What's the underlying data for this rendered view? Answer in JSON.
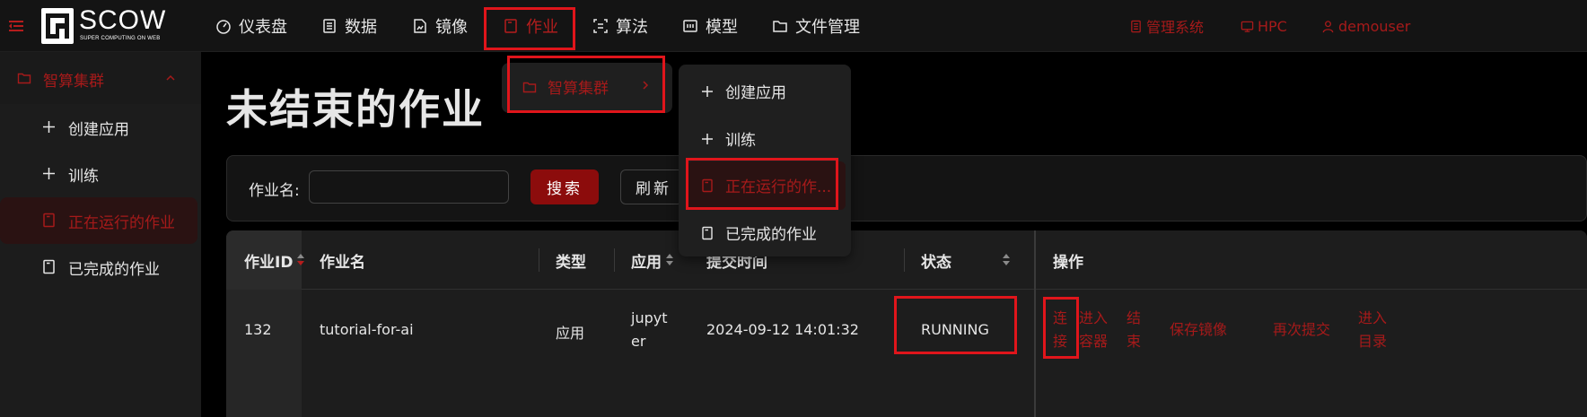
{
  "brand": {
    "name": "SCOW",
    "tagline": "SUPER COMPUTING ON WEB"
  },
  "nav": {
    "items": [
      {
        "label": "仪表盘",
        "icon": "dashboard-icon"
      },
      {
        "label": "数据",
        "icon": "database-icon"
      },
      {
        "label": "镜像",
        "icon": "image-file-icon"
      },
      {
        "label": "作业",
        "icon": "job-file-icon"
      },
      {
        "label": "算法",
        "icon": "algorithm-icon"
      },
      {
        "label": "模型",
        "icon": "model-icon"
      },
      {
        "label": "文件管理",
        "icon": "folder-icon"
      }
    ],
    "active_label": "作业",
    "right": [
      {
        "label": "管理系统",
        "icon": "admin-icon"
      },
      {
        "label": "HPC",
        "icon": "monitor-icon"
      },
      {
        "label": "demouser",
        "icon": "user-icon"
      }
    ]
  },
  "sidebar": {
    "group_label": "智算集群",
    "items": [
      {
        "label": "创建应用",
        "icon": "plus-icon"
      },
      {
        "label": "训练",
        "icon": "plus-icon"
      },
      {
        "label": "正在运行的作业",
        "icon": "job-file-icon"
      },
      {
        "label": "已完成的作业",
        "icon": "job-file-icon"
      }
    ],
    "active_label": "正在运行的作业"
  },
  "dropdown": {
    "cluster_label": "智算集群",
    "items": [
      {
        "label": "创建应用",
        "icon": "plus-icon"
      },
      {
        "label": "训练",
        "icon": "plus-icon"
      },
      {
        "label": "正在运行的作...",
        "icon": "job-file-icon"
      },
      {
        "label": "已完成的作业",
        "icon": "job-file-icon"
      }
    ],
    "active_label": "正在运行的作..."
  },
  "page": {
    "title": "未结束的作业"
  },
  "filter": {
    "name_label": "作业名:",
    "name_value": "",
    "search_label": "搜索",
    "refresh_label": "刷新"
  },
  "table": {
    "columns": [
      "作业ID",
      "作业名",
      "类型",
      "应用",
      "提交时间",
      "状态",
      "操作"
    ],
    "rows": [
      {
        "id": "132",
        "name": "tutorial-for-ai",
        "type": "应用",
        "app_line1": "jupyt",
        "app_line2": "er",
        "submit_time": "2024-09-12 14:01:32",
        "status": "RUNNING",
        "actions": {
          "connect_1": "连",
          "connect_2": "接",
          "enter_1": "进入",
          "enter_2": "容器",
          "end_1": "结",
          "end_2": "束",
          "save_image": "保存镜像",
          "resubmit": "再次提交",
          "enter_dir_1": "进入",
          "enter_dir_2": "目录"
        }
      }
    ]
  },
  "colors": {
    "accent": "#a61a1a",
    "primary_button": "#8c0c0c",
    "highlight_box": "#e0151b"
  }
}
